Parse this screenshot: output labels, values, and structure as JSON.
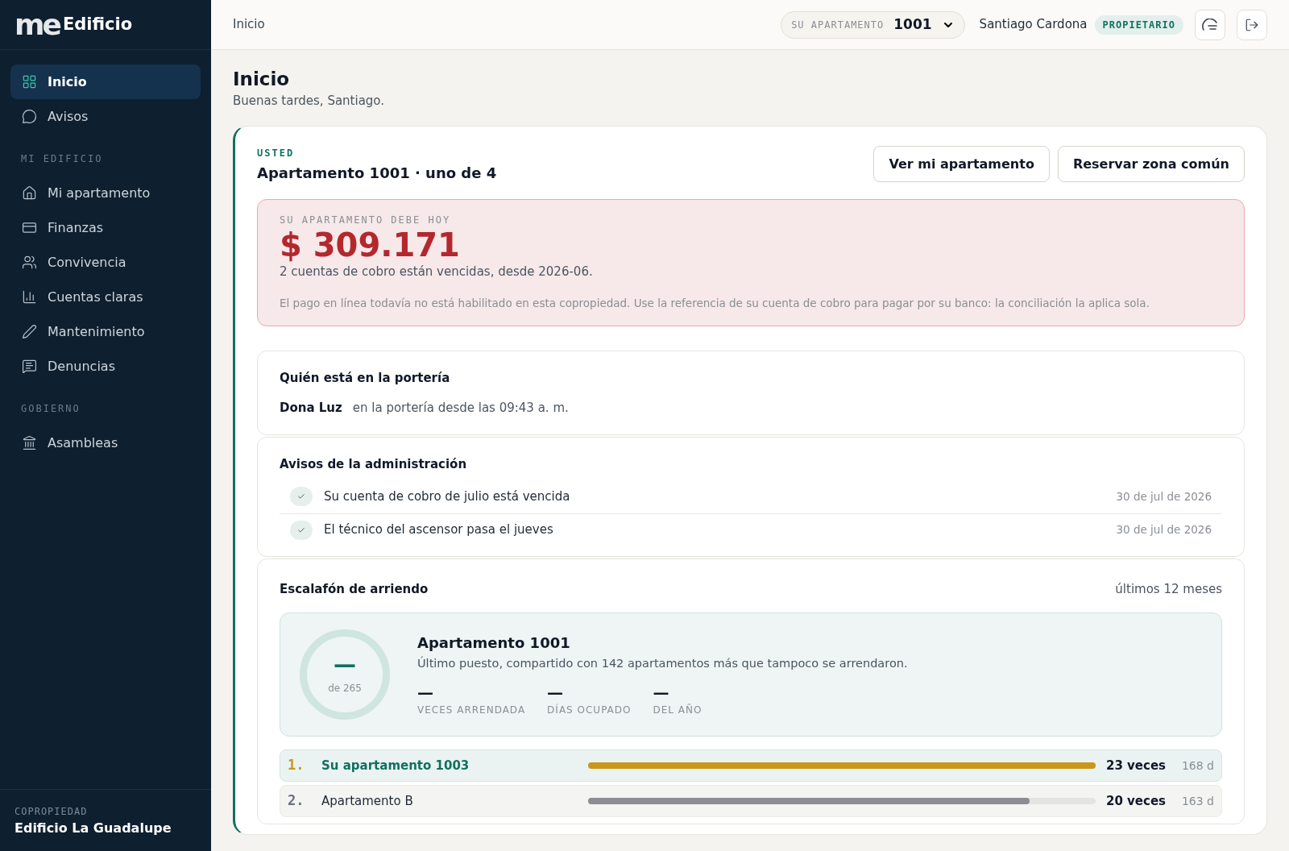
{
  "sidebar": {
    "logo_mark": "me",
    "logo_text": "Edificio",
    "groups": [
      {
        "items": [
          {
            "label": "Inicio",
            "kind": "grid",
            "selected": true
          },
          {
            "label": "Avisos",
            "kind": "chat",
            "selected": false
          }
        ]
      },
      {
        "heading": "MI EDIFICIO",
        "items": [
          {
            "label": "Mi apartamento",
            "kind": "home",
            "selected": false
          },
          {
            "label": "Finanzas",
            "kind": "card",
            "selected": false
          },
          {
            "label": "Convivencia",
            "kind": "users",
            "selected": false
          },
          {
            "label": "Cuentas claras",
            "kind": "chart",
            "selected": false
          },
          {
            "label": "Mantenimiento",
            "kind": "pen",
            "selected": false
          },
          {
            "label": "Denuncias",
            "kind": "message",
            "selected": false
          }
        ]
      },
      {
        "heading": "GOBIERNO",
        "items": [
          {
            "label": "Asambleas",
            "kind": "bank",
            "selected": false
          }
        ]
      }
    ],
    "footer": {
      "label": "COPROPIEDAD",
      "name": "Edificio La Guadalupe"
    }
  },
  "header": {
    "breadcrumb": "Inicio",
    "apartment_label": "SU APARTAMENTO",
    "apartment_value": "1001",
    "user": "Santiago Cardona",
    "role": "PROPIETARIO"
  },
  "page": {
    "title": "Inicio",
    "subtitle": "Buenas tardes, Santiago."
  },
  "unit_card": {
    "eyebrow": "USTED",
    "title": "Apartamento 1001 · uno de 4",
    "buttons": [
      "Ver mi apartamento",
      "Reservar zona común"
    ],
    "debt": {
      "label": "SU APARTAMENTO DEBE HOY",
      "amount": "$ 309.171",
      "detail": "2 cuentas de cobro están vencidas, desde 2026-06.",
      "note": "El pago en línea todavía no está habilitado en esta copropiedad. Use la referencia de su cuenta de cobro para pagar por su banco: la conciliación la aplica sola."
    }
  },
  "porteria": {
    "title": "Quién está en la portería",
    "name": "Dona Luz",
    "detail": "en la portería desde las 09:43 a. m."
  },
  "avisos": {
    "title": "Avisos de la administración",
    "items": [
      {
        "text": "Su cuenta de cobro de julio está vencida",
        "date": "30 de jul de 2026"
      },
      {
        "text": "El técnico del ascensor pasa el jueves",
        "date": "30 de jul de 2026"
      }
    ]
  },
  "ranking": {
    "title": "Escalafón de arriendo",
    "period": "últimos 12 meses",
    "summary": {
      "position": "—",
      "of": "de 265",
      "title": "Apartamento 1001",
      "text": "Último puesto, compartido con 142 apartamentos más que tampoco se arrendaron.",
      "stats": [
        {
          "value": "—",
          "label": "VECES ARRENDADA"
        },
        {
          "value": "—",
          "label": "DÍAS OCUPADO"
        },
        {
          "value": "—",
          "label": "DEL AÑO"
        }
      ]
    },
    "rows": [
      {
        "rank": "1.",
        "name": "Su apartamento 1003",
        "mine": true,
        "level": 1,
        "count": "23 veces",
        "days": "168 d"
      },
      {
        "rank": "2.",
        "name": "Apartamento B",
        "mine": false,
        "level": 0.87,
        "count": "20 veces",
        "days": "163 d"
      }
    ]
  }
}
